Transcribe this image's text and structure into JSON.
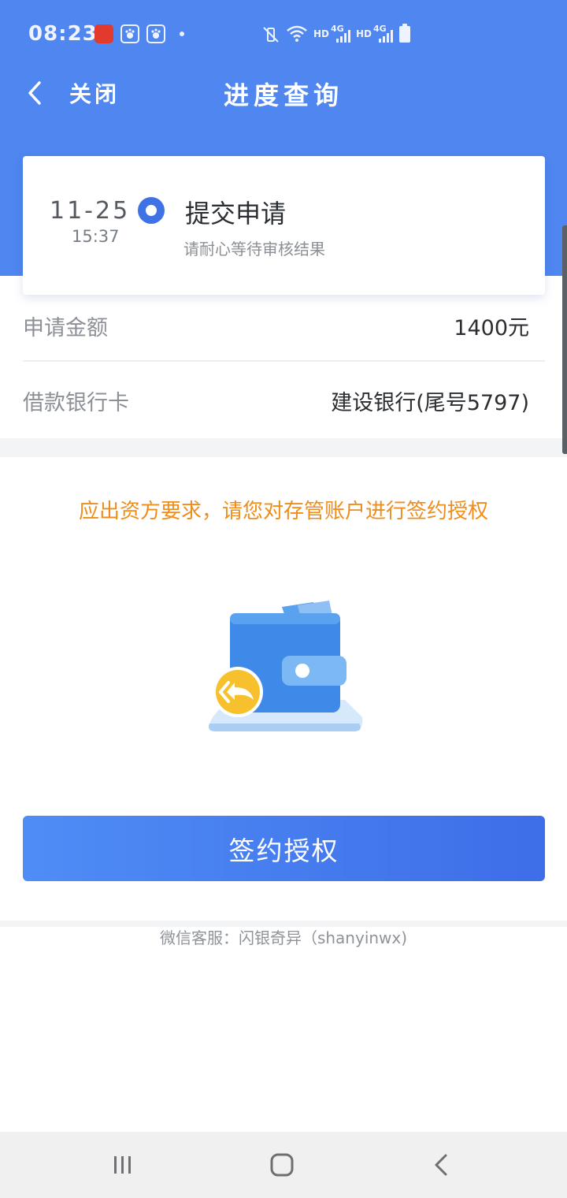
{
  "status_bar": {
    "time": "08:23",
    "net1": "HD",
    "sig1": "4G",
    "net2": "HD",
    "sig2": "4G"
  },
  "nav": {
    "close_label": "关闭",
    "title": "进度查询"
  },
  "progress": {
    "date": "11-25",
    "time": "15:37",
    "step_title": "提交申请",
    "step_desc": "请耐心等待审核结果"
  },
  "details": {
    "amount_label": "申请金额",
    "amount_value": "1400元",
    "bank_label": "借款银行卡",
    "bank_value": "建设银行(尾号5797)"
  },
  "notice": "应出资方要求，请您对存管账户进行签约授权",
  "sign_button_label": "签约授权",
  "service_text": "微信客服：闪银奇异（shanyinwx)",
  "colors": {
    "header_blue": "#4f86ef",
    "notice_orange": "#ee8d1c",
    "button_start": "#4f8df6",
    "button_end": "#3e6de8"
  },
  "icons": {
    "back": "chevron-left-icon",
    "wallet": "wallet-icon",
    "refund": "double-arrow-back-icon",
    "recents": "recent-apps-icon",
    "home": "home-icon",
    "sys_back": "system-back-icon"
  }
}
